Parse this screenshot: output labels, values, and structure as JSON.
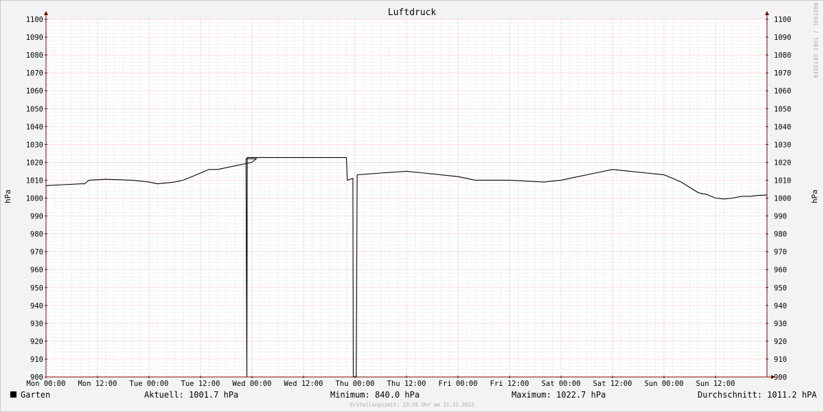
{
  "chart_data": {
    "type": "line",
    "title": "Luftdruck",
    "ylabel": "hPa",
    "ylim": [
      900,
      1100
    ],
    "y_ticks": [
      900,
      910,
      920,
      930,
      940,
      950,
      960,
      970,
      980,
      990,
      1000,
      1010,
      1020,
      1030,
      1040,
      1050,
      1060,
      1070,
      1080,
      1090,
      1100
    ],
    "x_ticks": [
      "Mon 00:00",
      "Mon 12:00",
      "Tue 00:00",
      "Tue 12:00",
      "Wed 00:00",
      "Wed 12:00",
      "Thu 00:00",
      "Thu 12:00",
      "Fri 00:00",
      "Fri 12:00",
      "Sat 00:00",
      "Sat 12:00",
      "Sun 00:00",
      "Sun 12:00"
    ],
    "x_unit": "hours",
    "xlim": [
      0,
      168
    ],
    "grid": true,
    "series": [
      {
        "name": "Garten",
        "color": "#000000",
        "points": [
          [
            0,
            1007
          ],
          [
            4,
            1007.5
          ],
          [
            8,
            1008
          ],
          [
            9,
            1008
          ],
          [
            10,
            1010
          ],
          [
            14,
            1010.5
          ],
          [
            20,
            1010
          ],
          [
            24,
            1009
          ],
          [
            26,
            1008
          ],
          [
            28,
            1008.5
          ],
          [
            30,
            1009
          ],
          [
            32,
            1010
          ],
          [
            34,
            1012
          ],
          [
            36,
            1014
          ],
          [
            37,
            1015
          ],
          [
            38,
            1016
          ],
          [
            40,
            1016
          ],
          [
            42,
            1017
          ],
          [
            44,
            1018
          ],
          [
            46,
            1019
          ],
          [
            48,
            1020
          ],
          [
            49,
            1022
          ],
          [
            46.6,
            1022
          ],
          [
            46.8,
            900
          ],
          [
            46.9,
            1022.7
          ],
          [
            70,
            1022.7
          ],
          [
            70.2,
            1010
          ],
          [
            71.5,
            1011
          ],
          [
            71.6,
            900
          ],
          [
            72.3,
            900
          ],
          [
            72.5,
            1013
          ],
          [
            78,
            1014
          ],
          [
            84,
            1015
          ],
          [
            88,
            1014
          ],
          [
            92,
            1013
          ],
          [
            96,
            1012
          ],
          [
            100,
            1010
          ],
          [
            108,
            1010
          ],
          [
            112,
            1009.5
          ],
          [
            116,
            1009
          ],
          [
            120,
            1010
          ],
          [
            124,
            1012
          ],
          [
            128,
            1014
          ],
          [
            132,
            1016
          ],
          [
            136,
            1015
          ],
          [
            140,
            1014
          ],
          [
            144,
            1013
          ],
          [
            146,
            1011
          ],
          [
            148,
            1009
          ],
          [
            150,
            1006
          ],
          [
            152,
            1003
          ],
          [
            154,
            1002
          ],
          [
            156,
            1000
          ],
          [
            158,
            999.5
          ],
          [
            160,
            1000
          ],
          [
            162,
            1001
          ],
          [
            164,
            1001
          ],
          [
            166,
            1001.5
          ],
          [
            168,
            1001.7
          ]
        ]
      }
    ],
    "legend": {
      "label": "Garten",
      "current": "Aktuell: 1001.7 hPa",
      "minimum": "Minimum: 840.0 hPa",
      "maximum": "Maximum: 1022.7 hPa",
      "average": "Durchschnitt: 1011.2 hPA"
    }
  },
  "watermark": "RRDTOOL / TOBI OETIKER",
  "footer": "Erstellungszeit: 23:55 Uhr am 31.12.2023",
  "colors": {
    "background": "#f3f3f3",
    "plot_background": "#ffffff",
    "major_grid": "#f2a3a3",
    "minor_grid": "#d8d8d8",
    "axis": "#7f0000",
    "line": "#000000"
  }
}
